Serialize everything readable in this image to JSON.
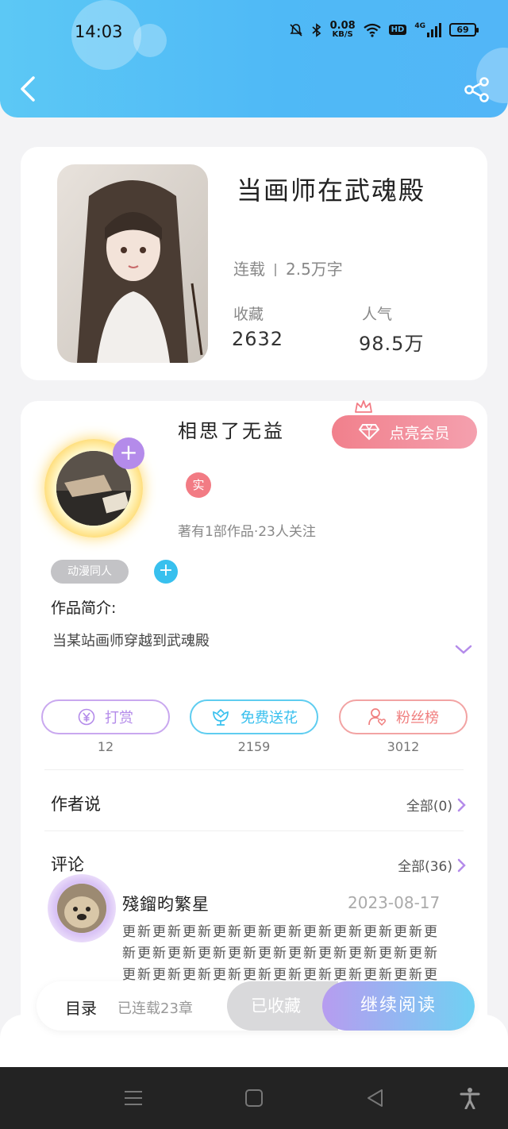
{
  "status_bar": {
    "time": "14:03",
    "net_speed_value": "0.08",
    "net_speed_unit": "KB/S",
    "hd": "HD",
    "network": "4G",
    "battery": "69"
  },
  "book": {
    "title": "当画师在武魂殿",
    "status": "连载",
    "word_count": "2.5万字",
    "favorites_label": "收藏",
    "favorites_value": "2632",
    "popularity_label": "人气",
    "popularity_value": "98.5万"
  },
  "author": {
    "name": "相思了无益",
    "vip_button": "点亮会员",
    "real_badge": "实",
    "meta": "著有1部作品·23人关注",
    "tag": "动漫同人",
    "tag_add": "+"
  },
  "intro": {
    "label": "作品简介:",
    "text": "当某站画师穿越到武魂殿"
  },
  "actions": [
    {
      "label": "打赏",
      "count": "12"
    },
    {
      "label": "免费送花",
      "count": "2159"
    },
    {
      "label": "粉丝榜",
      "count": "3012"
    }
  ],
  "author_says": {
    "title": "作者说",
    "link": "全部(0)"
  },
  "comments": {
    "title": "评论",
    "link": "全部(36)",
    "items": [
      {
        "user": "殘鎦昀繁星",
        "date": "2023-08-17",
        "text": "更新更新更新更新更新更新更新更新更新更新更新更新更新更新更新更新更新更新更新更新更新更新更新更新更新更新更新更新更新更新更新更新"
      }
    ]
  },
  "bottom_bar": {
    "toc_label": "目录",
    "toc_count": "已连载23章",
    "favorited": "已收藏",
    "continue_reading": "继续阅读"
  },
  "icons": {
    "back": "back-arrow-icon",
    "share": "share-icon",
    "nav_menu": "menu-icon",
    "nav_home": "home-icon",
    "nav_back": "nav-back-icon",
    "accessibility": "accessibility-icon"
  },
  "colors": {
    "header": "#4fb9f6",
    "vip": "#f1808c",
    "reward": "#b48bea",
    "flower": "#38c0ee",
    "fans": "#f07f7f",
    "read_button_start": "#b79cf0",
    "read_button_end": "#6fd1f3"
  }
}
